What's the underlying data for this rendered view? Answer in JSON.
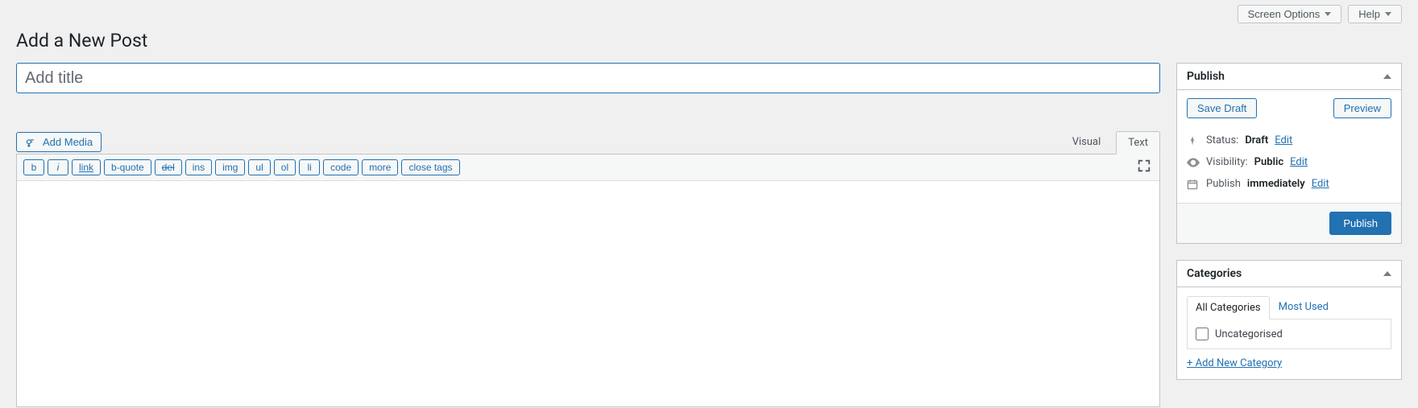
{
  "topbar": {
    "screen_options": "Screen Options",
    "help": "Help"
  },
  "heading": "Add a New Post",
  "title_input": {
    "placeholder": "Add title",
    "value": ""
  },
  "media_button": "Add Media",
  "editor_tabs": {
    "visual": "Visual",
    "text": "Text"
  },
  "quicktags": [
    "b",
    "i",
    "link",
    "b-quote",
    "del",
    "ins",
    "img",
    "ul",
    "ol",
    "li",
    "code",
    "more",
    "close tags"
  ],
  "publish": {
    "box_title": "Publish",
    "save_draft": "Save Draft",
    "preview": "Preview",
    "status_label": "Status:",
    "status_value": "Draft",
    "visibility_label": "Visibility:",
    "visibility_value": "Public",
    "schedule_label": "Publish",
    "schedule_value": "immediately",
    "edit": "Edit",
    "publish_button": "Publish"
  },
  "categories": {
    "box_title": "Categories",
    "tab_all": "All Categories",
    "tab_most": "Most Used",
    "items": [
      "Uncategorised"
    ],
    "add_new": "+ Add New Category"
  }
}
